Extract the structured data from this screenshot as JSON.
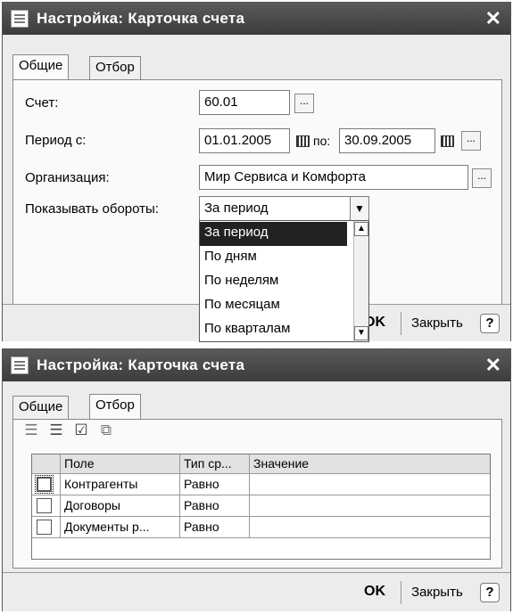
{
  "window1": {
    "title": "Настройка: Карточка счета",
    "tabs": [
      "Общие",
      "Отбор"
    ],
    "account_label": "Счет:",
    "account_value": "60.01",
    "period_label": "Период с:",
    "period_from": "01.01.2005",
    "period_to_label": "по:",
    "period_to": "30.09.2005",
    "org_label": "Организация:",
    "org_value": "Мир Сервиса и Комфорта",
    "show_label": "Показывать обороты:",
    "show_value": "За период",
    "dropdown_options": [
      "За период",
      "По дням",
      "По неделям",
      "По месяцам",
      "По кварталам"
    ],
    "ok_label": "OK",
    "close_label": "Закрыть",
    "help_label": "?",
    "ellipsis": "..."
  },
  "window2": {
    "title": "Настройка: Карточка счета",
    "tabs": [
      "Общие",
      "Отбор"
    ],
    "columns": [
      "Поле",
      "Тип ср...",
      "Значение"
    ],
    "rows": [
      {
        "field": "Контрагенты",
        "type": "Равно",
        "value": ""
      },
      {
        "field": "Договоры",
        "type": "Равно",
        "value": ""
      },
      {
        "field": "Документы р...",
        "type": "Равно",
        "value": ""
      }
    ],
    "ok_label": "OK",
    "close_label": "Закрыть",
    "help_label": "?"
  },
  "icons": {
    "window_icon": "document-icon",
    "close": "close-icon",
    "calendar": "calendar-icon",
    "dropdown": "chevron-down-icon",
    "toolbar": [
      "add-row-icon",
      "delete-row-icon",
      "check-all-icon",
      "copy-icon"
    ]
  }
}
